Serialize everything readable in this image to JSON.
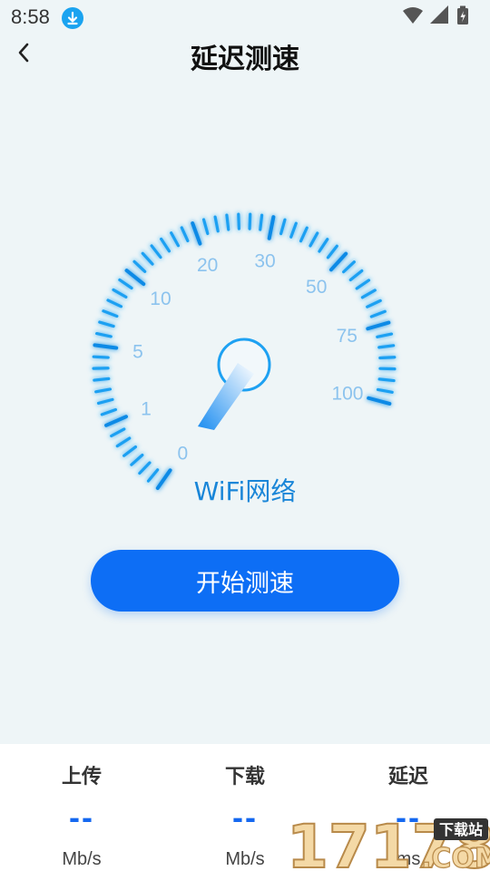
{
  "status_bar": {
    "time": "8:58",
    "download_indicator": "download-icon",
    "right_icons": [
      "wifi-icon",
      "signal-icon",
      "battery-charging-icon"
    ]
  },
  "header": {
    "back_icon": "chevron-left-icon",
    "title": "延迟测速"
  },
  "gauge": {
    "scale_labels": [
      "0",
      "1",
      "5",
      "10",
      "20",
      "30",
      "50",
      "75",
      "100"
    ],
    "network": "WiFi网络",
    "needle_value": 0,
    "accent_color": "#1da0f2"
  },
  "start_button": {
    "label": "开始测速",
    "color": "#0d6ef5"
  },
  "stats": [
    {
      "label": "上传",
      "value": "--",
      "unit": "Mb/s"
    },
    {
      "label": "下载",
      "value": "--",
      "unit": "Mb/s"
    },
    {
      "label": "延迟",
      "value": "--",
      "unit": "ms"
    }
  ],
  "watermark": {
    "number": "17178",
    "tag": "下载站",
    "domain": ".COM"
  }
}
